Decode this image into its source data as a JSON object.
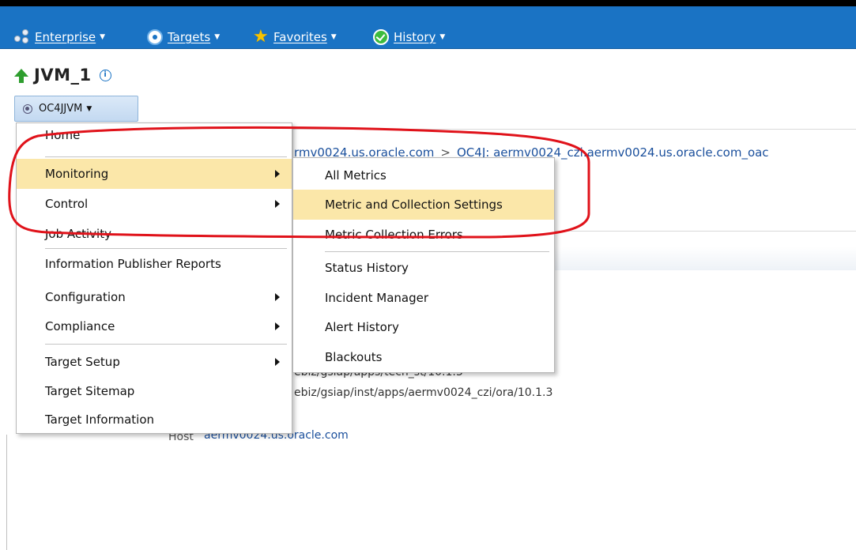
{
  "navbar": {
    "items": [
      {
        "label": "Enterprise",
        "icon": "enterprise-icon"
      },
      {
        "label": "Targets",
        "icon": "target-icon"
      },
      {
        "label": "Favorites",
        "icon": "star-icon"
      },
      {
        "label": "History",
        "icon": "history-icon"
      }
    ],
    "color": "#1a73c4"
  },
  "page": {
    "title": "JVM_1",
    "target_menu_label": "OC4JJVM"
  },
  "background": {
    "breadcrumb_part1": "rmv0024.us.oracle.com",
    "breadcrumb_sep": ">",
    "breadcrumb_part2": "OC4J: aermv0024_czi.aermv0024.us.oracle.com_oac",
    "path1": "ebiz/gsiap/apps/tech_st/10.1.3",
    "path2": "ebiz/gsiap/inst/apps/aermv0024_czi/ora/10.1.3",
    "host_label": "Host",
    "host_value": "aermv0024.us.oracle.com"
  },
  "menu": {
    "items": [
      {
        "label": "Home"
      },
      {
        "label": "Monitoring",
        "submenu": true,
        "selected": true
      },
      {
        "label": "Control",
        "submenu": true
      },
      {
        "label": "Job Activity"
      },
      {
        "label": "Information Publisher Reports"
      },
      {
        "label": "Configuration",
        "submenu": true
      },
      {
        "label": "Compliance",
        "submenu": true
      },
      {
        "label": "Target Setup",
        "submenu": true
      },
      {
        "label": "Target Sitemap"
      },
      {
        "label": "Target Information"
      }
    ]
  },
  "submenu": {
    "items": [
      {
        "label": "All Metrics"
      },
      {
        "label": "Metric and Collection Settings",
        "selected": true
      },
      {
        "label": "Metric Collection Errors"
      },
      {
        "label": "Status History"
      },
      {
        "label": "Incident Manager"
      },
      {
        "label": "Alert History"
      },
      {
        "label": "Blackouts"
      }
    ],
    "highlight_color": "#fbe7a9"
  },
  "annotation": {
    "color": "#e0121a"
  }
}
